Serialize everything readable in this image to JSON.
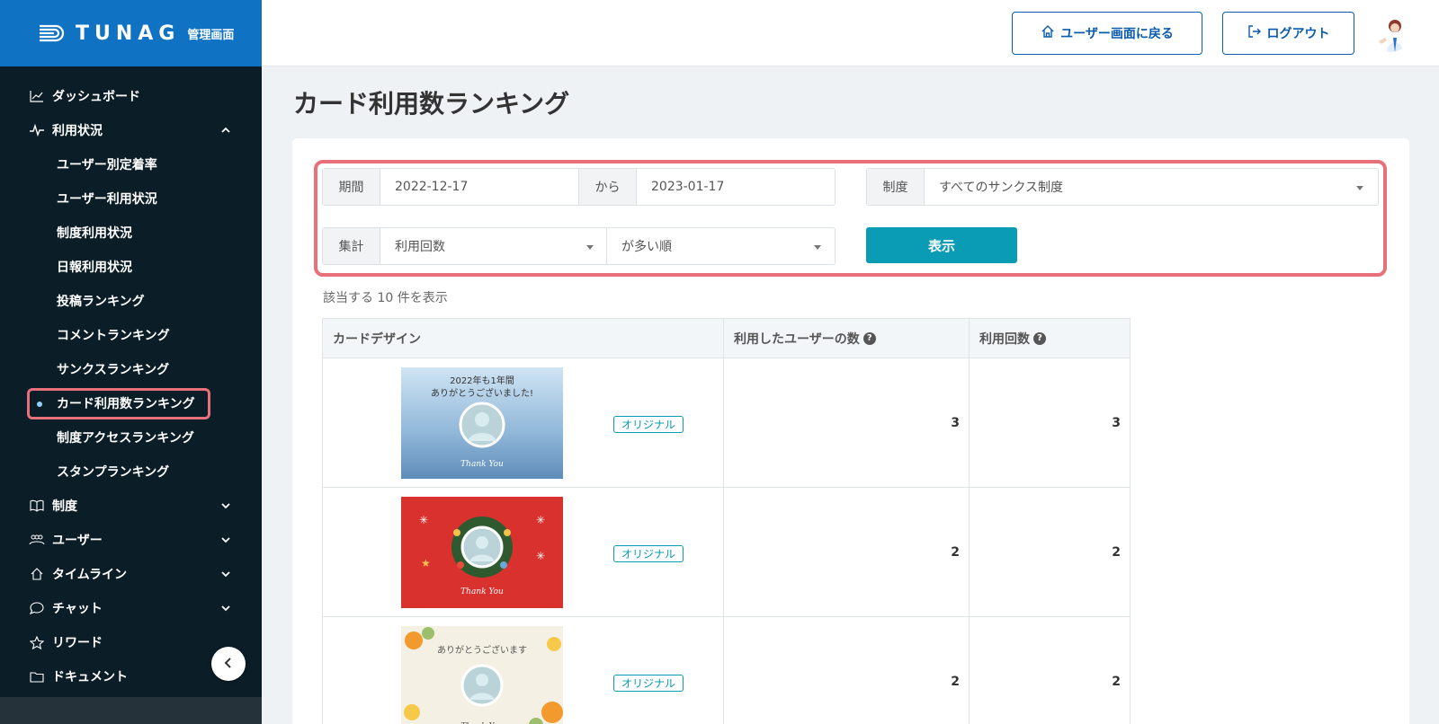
{
  "brand": {
    "logo": "TUNAG",
    "subtitle": "管理画面"
  },
  "sidebar": {
    "items": [
      {
        "label": "ダッシュボード",
        "icon": "chart-line-icon"
      },
      {
        "label": "利用状況",
        "icon": "pulse-icon",
        "expanded": true
      },
      {
        "label": "制度",
        "icon": "book-icon"
      },
      {
        "label": "ユーザー",
        "icon": "users-icon"
      },
      {
        "label": "タイムライン",
        "icon": "home-icon"
      },
      {
        "label": "チャット",
        "icon": "chat-icon"
      },
      {
        "label": "リワード",
        "icon": "star-icon"
      },
      {
        "label": "ドキュメント",
        "icon": "folder-icon"
      }
    ],
    "subitems": [
      "ユーザー別定着率",
      "ユーザー利用状況",
      "制度利用状況",
      "日報利用状況",
      "投稿ランキング",
      "コメントランキング",
      "サンクスランキング",
      "カード利用数ランキング",
      "制度アクセスランキング",
      "スタンプランキング"
    ],
    "active_subitem": "カード利用数ランキング"
  },
  "topbar": {
    "back_label": "ユーザー画面に戻る",
    "logout_label": "ログアウト"
  },
  "page": {
    "title": "カード利用数ランキング"
  },
  "filters": {
    "period_label": "期間",
    "from_date": "2022-12-17",
    "to_label": "から",
    "to_date": "2023-01-17",
    "system_label": "制度",
    "system_value": "すべてのサンクス制度",
    "aggregate_label": "集計",
    "aggregate_value": "利用回数",
    "order_value": "が多い順",
    "show_button": "表示"
  },
  "result_count": "該当する 10 件を表示",
  "table": {
    "headers": [
      "カードデザイン",
      "利用したユーザーの数",
      "利用回数"
    ],
    "rows": [
      {
        "card": "2022年も1年間 ありがとうございました! Thank You",
        "badge": "オリジナル",
        "users": "3",
        "uses": "3"
      },
      {
        "card": "Thank You",
        "badge": "オリジナル",
        "users": "2",
        "uses": "2"
      },
      {
        "card": "ありがとうございます Thank You",
        "badge": "オリジナル",
        "users": "2",
        "uses": "2"
      }
    ]
  },
  "colors": {
    "brand_blue": "#0f72c2",
    "sidebar_bg": "#0b1d26",
    "highlight": "#e8707a",
    "accent_teal": "#0a9bb5"
  }
}
